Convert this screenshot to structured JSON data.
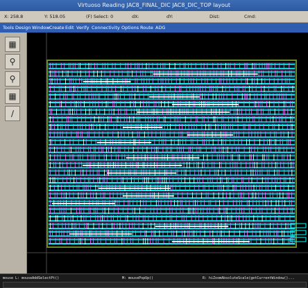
{
  "window": {
    "title": "Virtuoso Reading JAC8_FINAL_DIC JAC8_DIC_TOP layout"
  },
  "status": {
    "x": "X: 258.8",
    "y": "Y: 518.05",
    "select": "(F) Select: 0",
    "dx": "dX:",
    "dy": "dY:",
    "dist": "Dist:",
    "cmd": "Cmd:"
  },
  "menu": [
    "Tools",
    "Design",
    "Window",
    "Create",
    "Edit",
    "Verify",
    "Connectivity",
    "Options",
    "Route",
    "ADG"
  ],
  "toolbar": {
    "icons": [
      "save-icon",
      "zoom-in-icon",
      "zoom-out-icon",
      "fit-icon",
      "ruler-icon"
    ]
  },
  "bottom": {
    "left": "mouse L: mouseAddSelectPt()",
    "middle": "M: mousePopUp()",
    "right": "R: hiZoomAbsoluteScale(getCurrentWindow()..."
  },
  "colors": {
    "layout_bg": "#000000",
    "metal": "#00ffff",
    "poly": "#b08cff",
    "via": "#ff6bff",
    "boundary": "#6c8c2a"
  }
}
